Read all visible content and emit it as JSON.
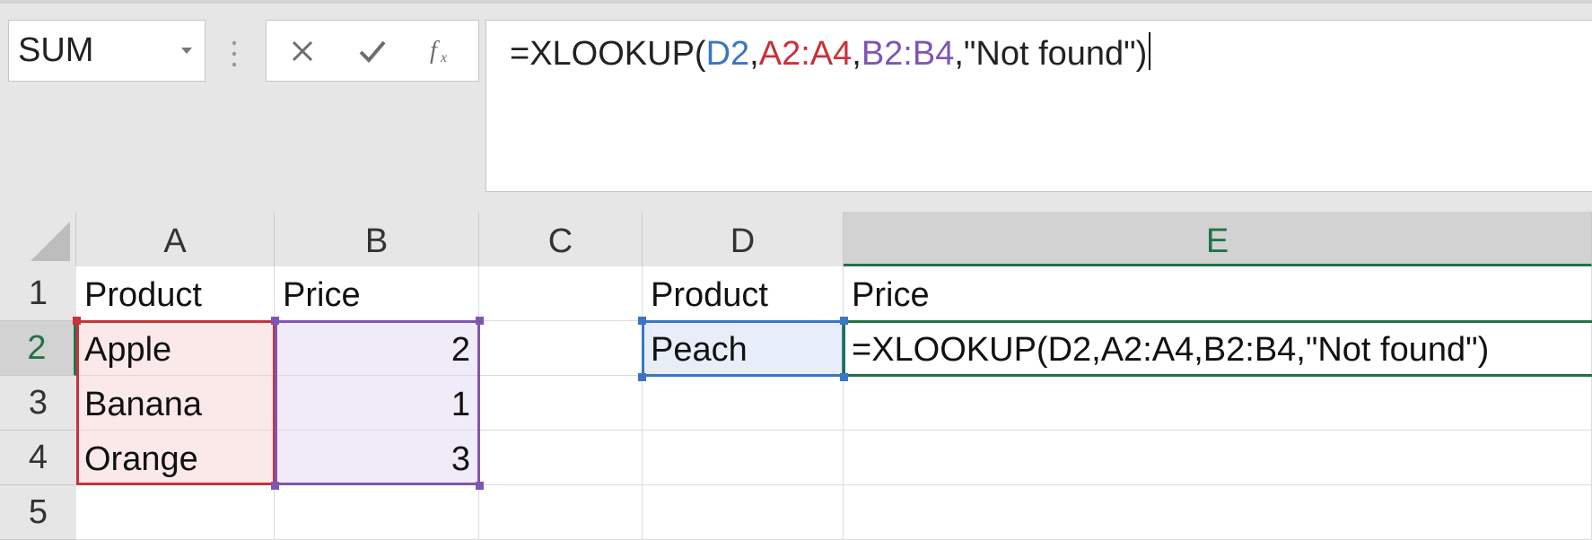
{
  "name_box": {
    "value": "SUM",
    "dropdown_icon": "chevron-down-icon"
  },
  "formula_bar": {
    "icons": [
      "cancel-icon",
      "enter-check-icon",
      "insert-function-icon"
    ],
    "formula_parts": {
      "p1": "=XLOOKUP(",
      "p2": "D2",
      "p3": ",",
      "p4": "A2:A4",
      "p5": ",",
      "p6": "B2:B4",
      "p7": ",\"Not found\")"
    }
  },
  "grid": {
    "column_headers": [
      "A",
      "B",
      "C",
      "D",
      "E"
    ],
    "row_headers": [
      "1",
      "2",
      "3",
      "4",
      "5"
    ],
    "cells": {
      "A1": "Product",
      "B1": "Price",
      "D1": "Product",
      "E1": "Price",
      "A2": "Apple",
      "B2": "2",
      "D2": "Peach",
      "E2": "=XLOOKUP(D2,A2:A4,B2:B4,\"Not found\")",
      "A3": "Banana",
      "B3": "1",
      "A4": "Orange",
      "B4": "3"
    },
    "active_cell": "E2"
  },
  "colors": {
    "ref_blue": "#3a76c4",
    "ref_red": "#c8323a",
    "ref_purple": "#7e56b5",
    "active_green": "#217346"
  }
}
